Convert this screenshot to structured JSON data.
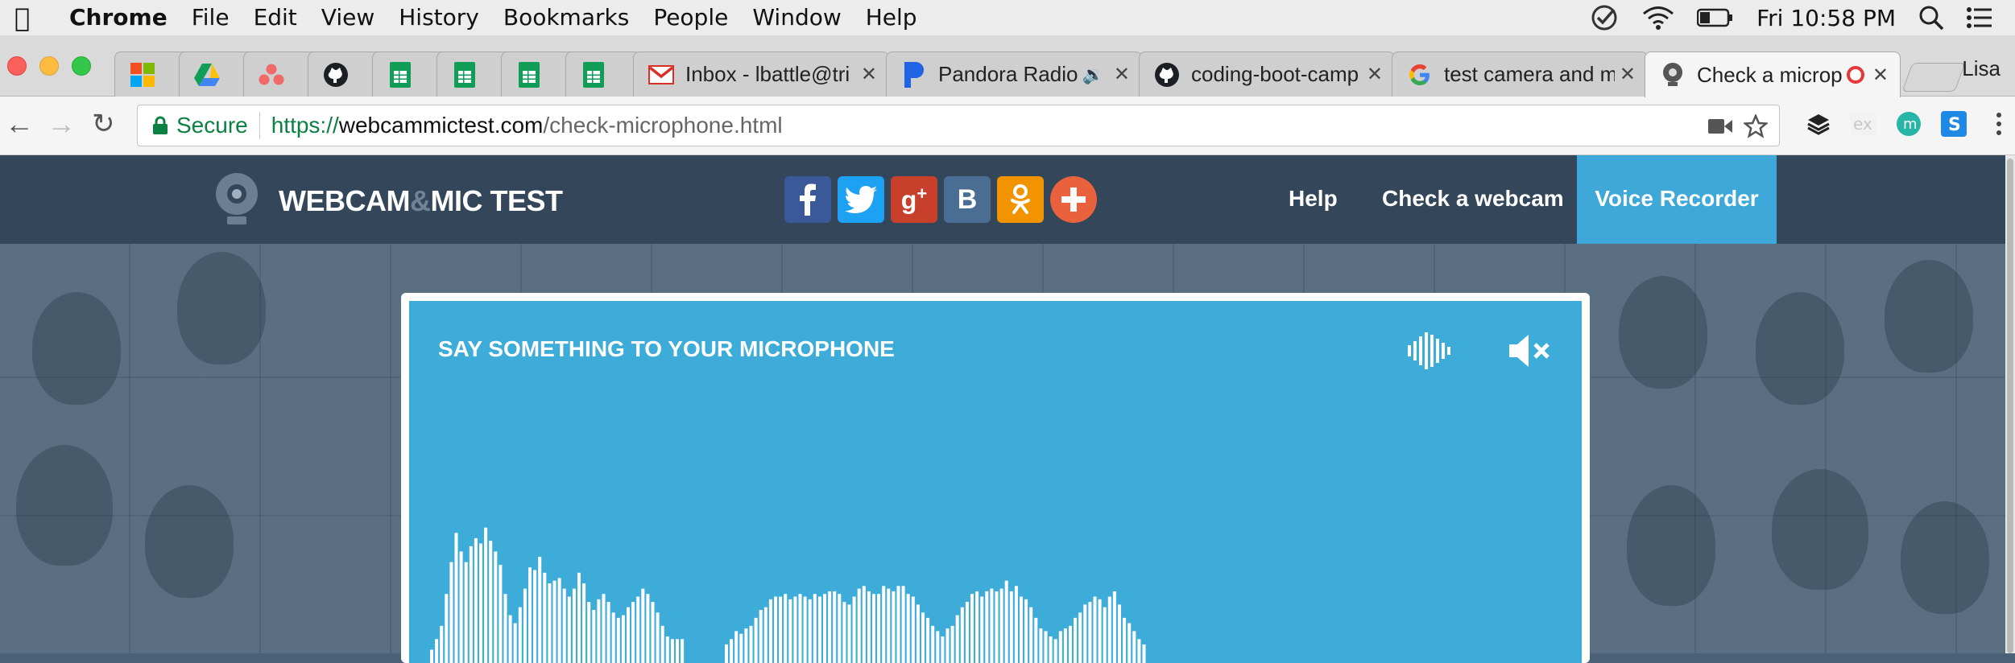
{
  "menubar": {
    "app": "Chrome",
    "items": [
      "File",
      "Edit",
      "View",
      "History",
      "Bookmarks",
      "People",
      "Window",
      "Help"
    ],
    "clock": "Fri 10:58 PM"
  },
  "tabs": [
    {
      "icon": "microsoft-icon",
      "title": ""
    },
    {
      "icon": "google-drive-icon",
      "title": ""
    },
    {
      "icon": "asana-icon",
      "title": ""
    },
    {
      "icon": "github-icon",
      "title": ""
    },
    {
      "icon": "sheets-icon",
      "title": ""
    },
    {
      "icon": "sheets-icon",
      "title": ""
    },
    {
      "icon": "sheets-icon",
      "title": ""
    },
    {
      "icon": "sheets-icon",
      "title": ""
    },
    {
      "icon": "gmail-icon",
      "title": "Inbox - lbattle@tri"
    },
    {
      "icon": "pandora-icon",
      "title": "Pandora Radio"
    },
    {
      "icon": "github-icon",
      "title": "coding-boot-camp"
    },
    {
      "icon": "google-icon",
      "title": "test camera and m"
    },
    {
      "icon": "webcam-icon",
      "title": "Check a microp"
    }
  ],
  "profile": "Lisa",
  "omnibox": {
    "secure": "Secure",
    "scheme": "https://",
    "host": "webcammictest.com",
    "path": "/check-microphone.html"
  },
  "site": {
    "logo_a": "WEBCAM",
    "logo_amp": "&",
    "logo_b": "MIC TEST",
    "social": [
      {
        "name": "facebook",
        "glyph": "f",
        "color": "#3b5998"
      },
      {
        "name": "twitter",
        "glyph": "t",
        "color": "#1da1f2"
      },
      {
        "name": "google-plus",
        "glyph": "g+",
        "color": "#c8402c"
      },
      {
        "name": "vk",
        "glyph": "B",
        "color": "#4a6d94"
      },
      {
        "name": "odnoklassniki",
        "glyph": "ok",
        "color": "#f29300"
      },
      {
        "name": "share",
        "glyph": "+",
        "color": "#e9623d"
      }
    ],
    "nav": {
      "help": "Help",
      "webcam": "Check a webcam",
      "voice": "Voice Recorder"
    }
  },
  "panel": {
    "title": "SAY SOMETHING TO YOUR MICROPHONE",
    "levels": [
      5,
      9,
      14,
      26,
      38,
      49,
      42,
      38,
      44,
      47,
      45,
      51,
      46,
      42,
      37,
      26,
      18,
      15,
      21,
      28,
      36,
      35,
      40,
      34,
      30,
      31,
      32,
      28,
      25,
      28,
      34,
      30,
      23,
      20,
      24,
      26,
      23,
      19,
      17,
      18,
      21,
      23,
      25,
      28,
      26,
      23,
      19,
      14,
      10,
      9,
      9,
      9,
      0,
      0,
      0,
      0,
      0,
      0,
      0,
      0,
      7,
      9,
      12,
      11,
      13,
      14,
      17,
      20,
      21,
      24,
      25,
      25,
      26,
      24,
      25,
      26,
      25,
      24,
      26,
      25,
      26,
      27,
      27,
      26,
      23,
      22,
      25,
      28,
      29,
      27,
      26,
      26,
      29,
      28,
      27,
      29,
      29,
      26,
      25,
      22,
      19,
      17,
      14,
      12,
      10,
      13,
      14,
      18,
      21,
      23,
      26,
      27,
      25,
      27,
      28,
      27,
      28,
      31,
      27,
      29,
      25,
      24,
      21,
      17,
      13,
      12,
      10,
      9,
      12,
      13,
      14,
      17,
      19,
      22,
      23,
      25,
      24,
      21,
      25,
      27,
      22,
      17,
      15,
      12,
      9,
      7
    ]
  }
}
